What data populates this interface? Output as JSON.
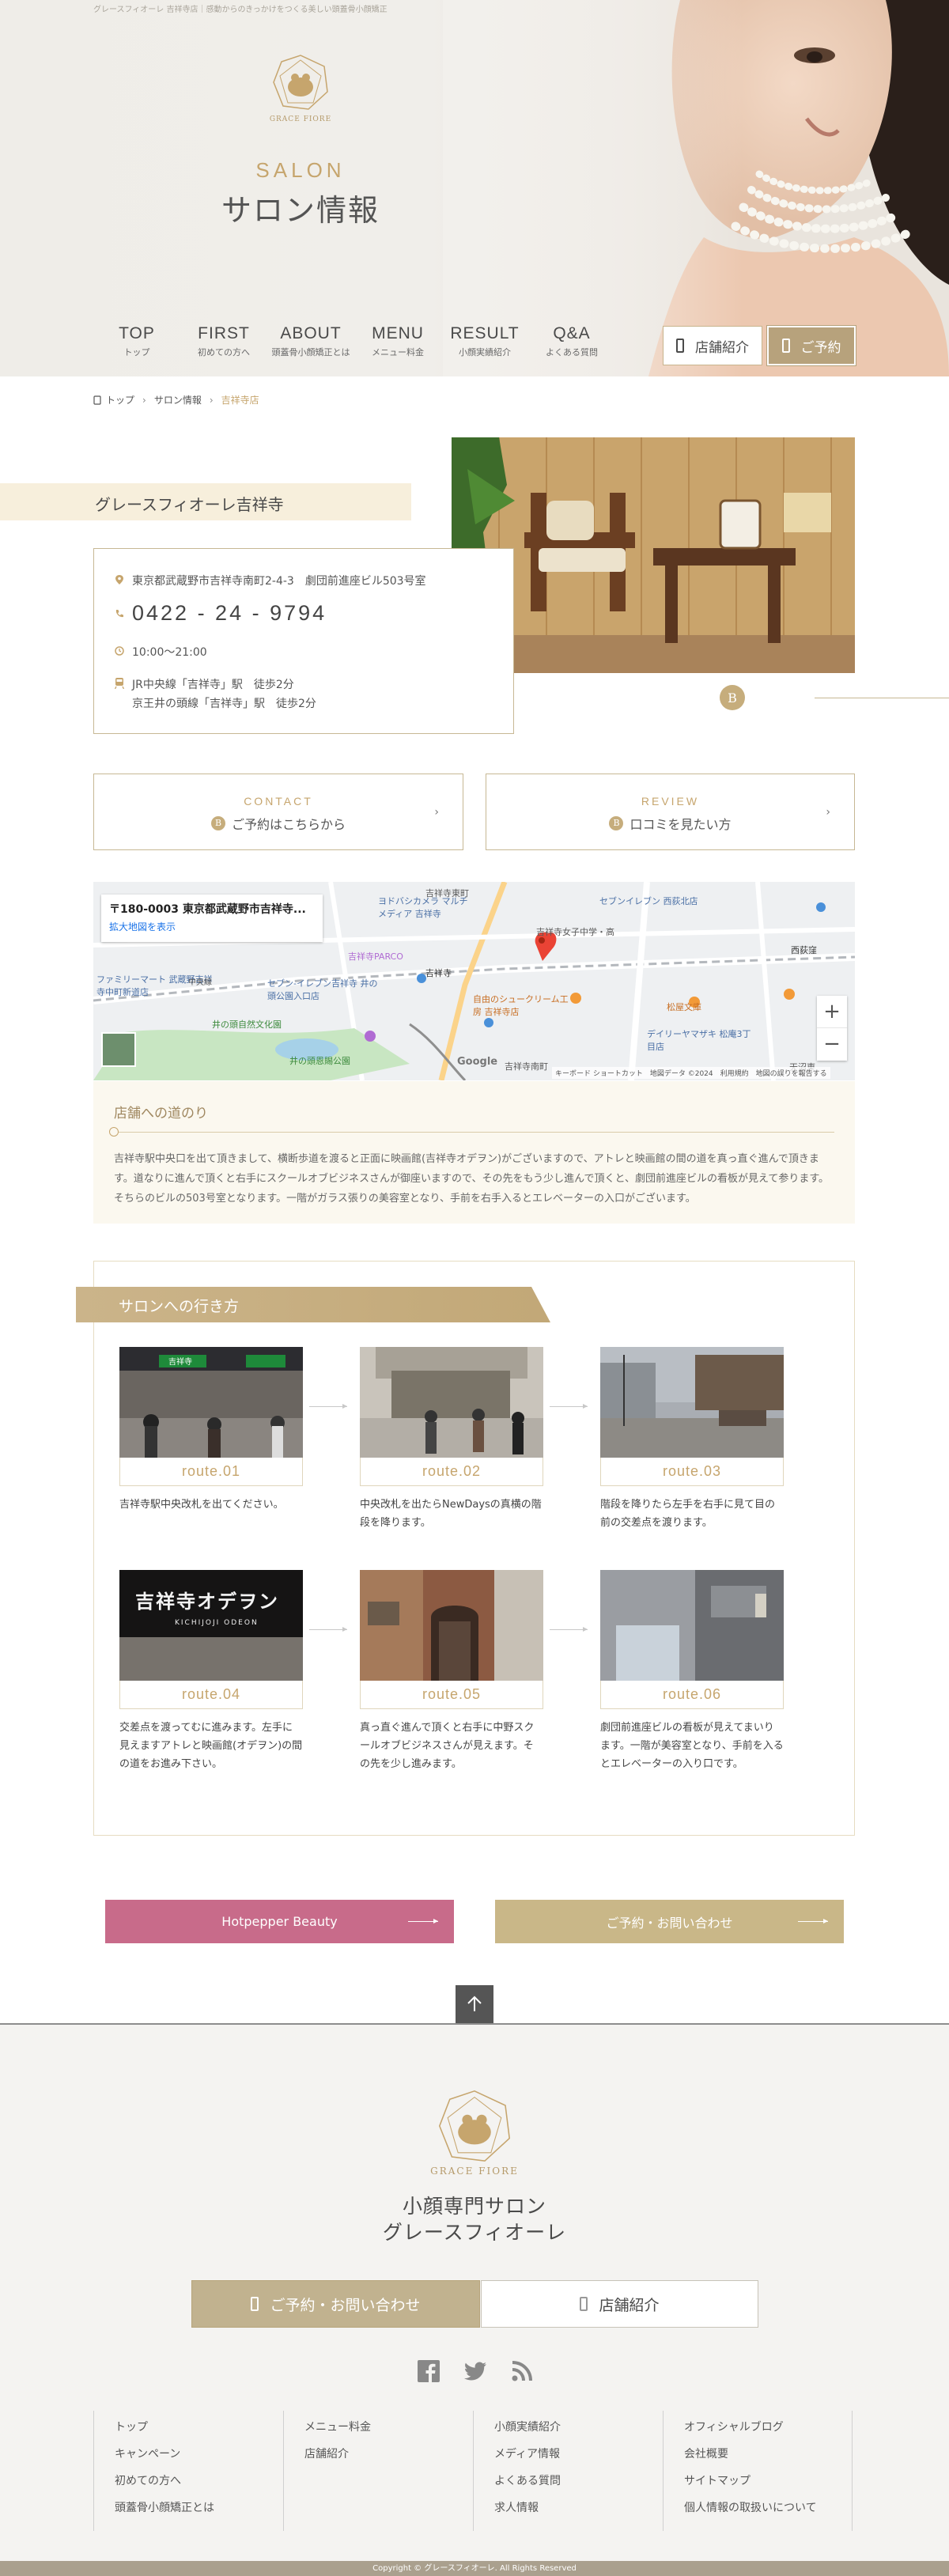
{
  "header": {
    "tagline": "グレースフィオーレ 吉祥寺店｜感動からのきっかけをつくる美しい頭蓋骨小顔矯正",
    "logo_text": "GRACE FIORE",
    "page_title_en": "SALON",
    "page_title_jp": "サロン情報"
  },
  "nav": {
    "items": [
      {
        "en": "TOP",
        "jp": "トップ"
      },
      {
        "en": "FIRST",
        "jp": "初めての方へ"
      },
      {
        "en": "ABOUT",
        "jp": "頭蓋骨小顔矯正とは"
      },
      {
        "en": "MENU",
        "jp": "メニュー料金"
      },
      {
        "en": "RESULT",
        "jp": "小顔実績紹介"
      },
      {
        "en": "Q&A",
        "jp": "よくある質問"
      }
    ],
    "shop_button": "店舗紹介",
    "reserve_button": "ご予約"
  },
  "breadcrumb": {
    "items": [
      "トップ",
      "サロン情報",
      "吉祥寺店"
    ]
  },
  "store": {
    "name": "グレースフィオーレ吉祥寺",
    "address": "東京都武蔵野市吉祥寺南町2-4-3　劇団前進座ビル503号室",
    "tel": "0422 - 24 - 9794",
    "hours": "10:00～21:00",
    "access_1": "JR中央線「吉祥寺」駅　徒歩2分",
    "access_2": "京王井の頭線「吉祥寺」駅　徒歩2分",
    "badge": "B"
  },
  "links": {
    "contact_en": "CONTACT",
    "contact_jp": "ご予約はこちらから",
    "review_en": "REVIEW",
    "review_jp": "口コミを見たい方",
    "badge": "B"
  },
  "map": {
    "address": "〒180-0003 東京都武蔵野市吉祥寺...",
    "link": "拡大地図を表示",
    "footer": "キーボード ショートカット　地図データ ©2024　利用規約　地図の誤りを報告する",
    "google": "Google",
    "zoom_in": "+",
    "zoom_out": "−",
    "labels": [
      "吉祥寺東町",
      "ヨドバシカメラ マルチメディア 吉祥寺",
      "セブンイレブン 西荻北店",
      "吉祥寺PARCO",
      "吉祥寺",
      "吉祥寺女子中学・高",
      "西荻窪",
      "ファミリーマート 武蔵野吉祥寺中町新道店",
      "セブン-イレブン吉祥寺 井の頭公園入口店",
      "自由のシュークリーム工房 吉祥寺店",
      "松屋文庫",
      "井の頭自然文化園",
      "井の頭恩賜公園",
      "デイリーヤマザキ 松庵3丁目店",
      "吉祥寺南町",
      "中央線",
      "天沼東"
    ]
  },
  "directions": {
    "title": "店舗への道のり",
    "text": "吉祥寺駅中央口を出て頂きまして、横断歩道を渡ると正面に映画館(吉祥寺オデヲン)がございますので、アトレと映画館の間の道を真っ直ぐ進んで頂きます。道なりに進んで頂くと右手にスクールオブビジネスさんが御座いますので、その先をもう少し進んで頂くと、劇団前進座ビルの看板が見えて参ります。そちらのビルの503号室となります。一階がガラス張りの美容室となり、手前を右手入るとエレベーターの入口がございます。"
  },
  "routes": {
    "title": "サロンへの行き方",
    "items": [
      {
        "label": "route.01",
        "desc": "吉祥寺駅中央改札を出てください。"
      },
      {
        "label": "route.02",
        "desc": "中央改札を出たらNewDaysの真横の階段を降ります。"
      },
      {
        "label": "route.03",
        "desc": "階段を降りたら左手を右手に見て目の前の交差点を渡ります。"
      },
      {
        "label": "route.04",
        "desc": "交差点を渡ってむに進みます。左手に見えますアトレと映画館(オデヲン)の間の道をお進み下さい。"
      },
      {
        "label": "route.05",
        "desc": "真っ直ぐ進んで頂くと右手に中野スクールオブビジネスさんが見えます。その先を少し進みます。"
      },
      {
        "label": "route.06",
        "desc": "劇団前進座ビルの看板が見えてまいります。一階が美容室となり、手前を入るとエレベーターの入り口です。"
      }
    ],
    "sign_4": "吉祥寺オデヲン",
    "sign_4_sub": "KICHIJOJI ODEON",
    "sign_1": "吉祥寺"
  },
  "cta": {
    "hotpepper": "Hotpepper Beauty",
    "contact": "ご予約・お問い合わせ"
  },
  "footer": {
    "logo_text": "GRACE FIORE",
    "name_1": "小顔専門サロン",
    "name_2": "グレースフィオーレ",
    "btn_contact": "ご予約・お問い合わせ",
    "btn_shop": "店舗紹介",
    "columns": [
      [
        "トップ",
        "キャンペーン",
        "初めての方へ",
        "頭蓋骨小顔矯正とは"
      ],
      [
        "メニュー料金",
        "店舗紹介"
      ],
      [
        "小顔実績紹介",
        "メディア情報",
        "よくある質問",
        "求人情報"
      ],
      [
        "オフィシャルブログ",
        "会社概要",
        "サイトマップ",
        "個人情報の取扱いについて"
      ]
    ],
    "copyright": "Copyright © グレースフィオーレ. All Rights Reserved"
  },
  "colors": {
    "gold": "#c6a56d",
    "beige_button": "#b7a27c",
    "pink_button": "#c86b8a",
    "footer_bg": "#f4f3f1"
  }
}
